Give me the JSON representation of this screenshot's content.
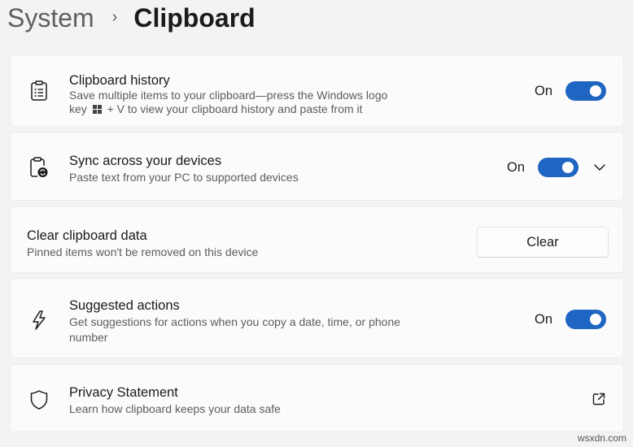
{
  "breadcrumb": {
    "parent": "System",
    "separator": "›",
    "current": "Clipboard"
  },
  "clipboard_history": {
    "title": "Clipboard history",
    "desc_line1": "Save multiple items to your clipboard—press the Windows logo",
    "desc_line2_pre": "key",
    "desc_line2_post": "+ V to view your clipboard history and paste from it",
    "toggle_label": "On",
    "toggle_on": true,
    "icon": "clipboard-list-icon"
  },
  "sync": {
    "title": "Sync across your devices",
    "desc": "Paste text from your PC to supported devices",
    "toggle_label": "On",
    "toggle_on": true,
    "icon": "clipboard-sync-icon"
  },
  "clear": {
    "title": "Clear clipboard data",
    "desc": "Pinned items won't be removed on this device",
    "button_label": "Clear"
  },
  "suggested": {
    "title": "Suggested actions",
    "desc_line1": "Get suggestions for actions when you copy a date, time, or phone",
    "desc_line2": "number",
    "toggle_label": "On",
    "toggle_on": true,
    "icon": "lightning-icon"
  },
  "privacy": {
    "title": "Privacy Statement",
    "desc": "Learn how clipboard keeps your data safe",
    "icon": "shield-icon"
  },
  "watermark": "wsxdn.com",
  "colors": {
    "accent": "#1f66c2",
    "background": "#f3f3f3",
    "card": "#fbfbfb"
  }
}
